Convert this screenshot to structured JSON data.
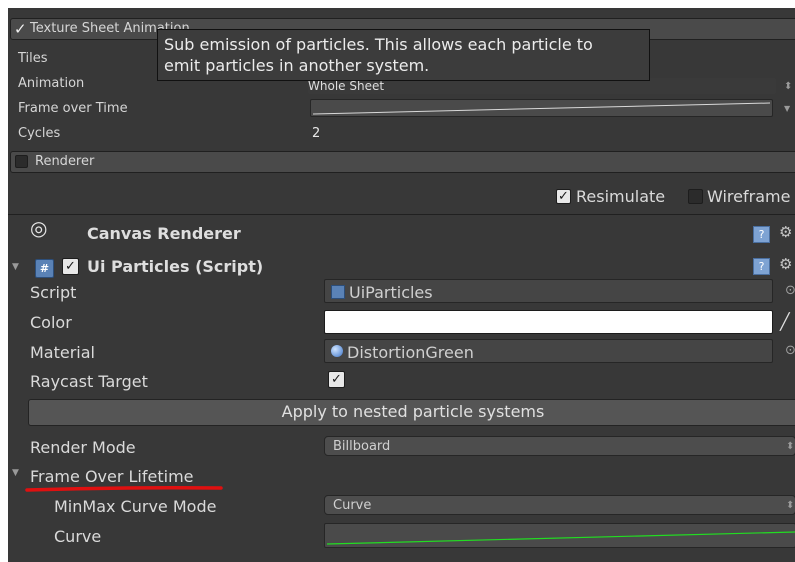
{
  "tooltip": {
    "line1": "Sub emission of particles. This allows each particle to",
    "line2": "emit particles in another system."
  },
  "texture_sheet": {
    "header": "Texture Sheet Animation",
    "tiles_label": "Tiles",
    "animation_label": "Animation",
    "animation_value": "Whole Sheet",
    "frame_over_time_label": "Frame over Time",
    "cycles_label": "Cycles",
    "cycles_value": "2"
  },
  "renderer_header": "Renderer",
  "toolbar": {
    "resimulate_label": "Resimulate",
    "resimulate_checked": true,
    "wireframe_label": "Wireframe",
    "wireframe_checked": false
  },
  "canvas_renderer": {
    "title": "Canvas Renderer"
  },
  "ui_particles": {
    "title": "Ui Particles (Script)",
    "script_label": "Script",
    "script_value": "UiParticles",
    "color_label": "Color",
    "color_value": "#ffffff",
    "material_label": "Material",
    "material_value": "DistortionGreen",
    "raycast_label": "Raycast Target",
    "raycast_checked": true,
    "apply_button": "Apply to nested particle systems",
    "render_mode_label": "Render Mode",
    "render_mode_value": "Billboard",
    "frame_over_lifetime_label": "Frame Over Lifetime",
    "minmax_label": "MinMax Curve Mode",
    "minmax_value": "Curve",
    "curve_label": "Curve"
  },
  "icons": {
    "check": "✓",
    "gear": "⚙",
    "help": "?",
    "dropdown_arrows": "⬍",
    "triangle_down": "▼",
    "eye": "◎",
    "script_glyph": "#",
    "object_picker": "⊙",
    "eyedropper": "╱"
  },
  "colors": {
    "annotation_underline": "#e01010",
    "curve_green": "#22dd22",
    "help_blue": "#7ea3d3"
  }
}
